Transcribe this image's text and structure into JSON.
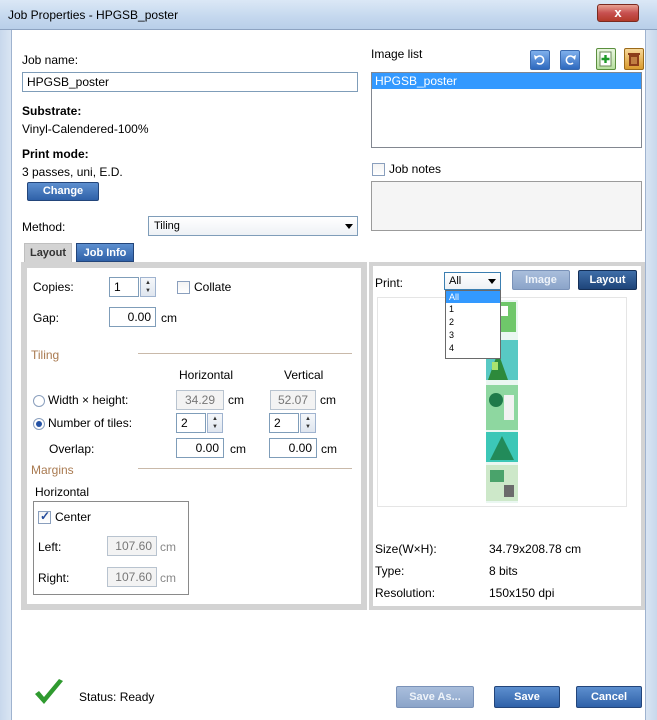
{
  "window": {
    "title": "Job Properties - HPGSB_poster",
    "close_glyph": "x"
  },
  "job": {
    "name_label": "Job name:",
    "name_value": "HPGSB_poster",
    "substrate_label": "Substrate:",
    "substrate_value": "Vinyl-Calendered-100%",
    "printmode_label": "Print mode:",
    "printmode_value": "3 passes, uni, E.D.",
    "change_button": "Change",
    "method_label": "Method:",
    "method_value": "Tiling"
  },
  "image_list": {
    "label": "Image list",
    "items": [
      "HPGSB_poster"
    ],
    "icons": [
      "rotate-left-icon",
      "rotate-right-icon",
      "add-image-icon",
      "delete-icon"
    ]
  },
  "job_notes": {
    "label": "Job notes",
    "checked": false,
    "text": ""
  },
  "tabs": [
    {
      "label": "Layout",
      "active": true
    },
    {
      "label": "Job Info",
      "active": false
    }
  ],
  "layout": {
    "copies_label": "Copies:",
    "copies_value": "1",
    "collate_label": "Collate",
    "collate_checked": false,
    "gap_label": "Gap:",
    "gap_value": "0.00",
    "gap_unit": "cm",
    "tiling_header": "Tiling",
    "col_horizontal": "Horizontal",
    "col_vertical": "Vertical",
    "wh_label": "Width × height:",
    "wh_horizontal": "34.29",
    "wh_vertical": "52.07",
    "unit": "cm",
    "tiles_label": "Number of tiles:",
    "tiles_horizontal": "2",
    "tiles_vertical": "2",
    "overlap_label": "Overlap:",
    "overlap_horizontal": "0.00",
    "overlap_vertical": "0.00",
    "margins_header": "Margins",
    "margins_horizontal_label": "Horizontal",
    "center_label": "Center",
    "center_checked": true,
    "left_label": "Left:",
    "left_value": "107.60",
    "right_label": "Right:",
    "right_value": "107.60",
    "selected_mode": "tiles"
  },
  "preview": {
    "print_label": "Print:",
    "print_value": "All",
    "print_options": [
      "All",
      "1",
      "2",
      "3",
      "4"
    ],
    "image_button": "Image",
    "layout_button": "Layout",
    "size_label": "Size(W×H):",
    "size_value": "34.79x208.78 cm",
    "type_label": "Type:",
    "type_value": "8 bits",
    "resolution_label": "Resolution:",
    "resolution_value": "150x150 dpi"
  },
  "status": {
    "text": "Status: Ready",
    "icon": "checkmark-icon",
    "color": "#2f9a2f"
  },
  "footer": {
    "save_as": "Save As...",
    "save": "Save",
    "cancel": "Cancel"
  }
}
